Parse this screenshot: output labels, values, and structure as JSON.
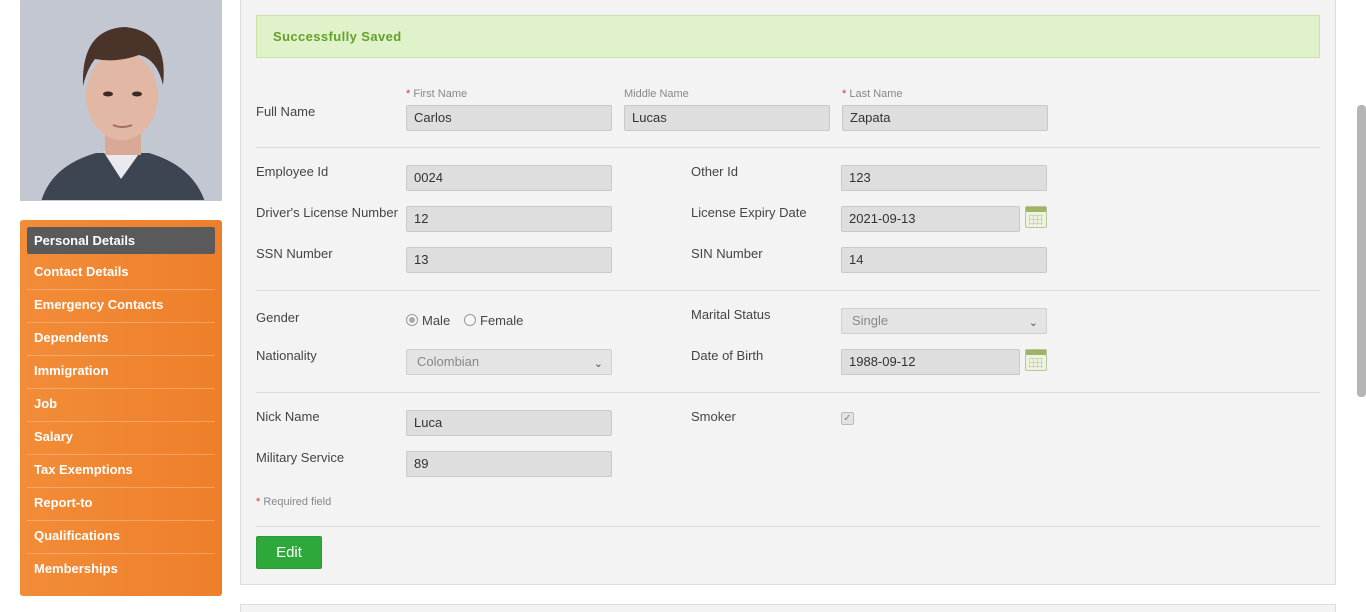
{
  "sidebar": {
    "items": [
      {
        "label": "Personal Details",
        "active": true
      },
      {
        "label": "Contact Details"
      },
      {
        "label": "Emergency Contacts"
      },
      {
        "label": "Dependents"
      },
      {
        "label": "Immigration"
      },
      {
        "label": "Job"
      },
      {
        "label": "Salary"
      },
      {
        "label": "Tax Exemptions"
      },
      {
        "label": "Report-to"
      },
      {
        "label": "Qualifications"
      },
      {
        "label": "Memberships"
      }
    ]
  },
  "alert": {
    "message": "Successfully Saved"
  },
  "form": {
    "full_name": {
      "label": "Full Name",
      "first_label": "First Name",
      "first_value": "Carlos",
      "middle_label": "Middle Name",
      "middle_value": "Lucas",
      "last_label": "Last Name",
      "last_value": "Zapata",
      "required_mark": "*"
    },
    "employee_id": {
      "label": "Employee Id",
      "value": "0024"
    },
    "other_id": {
      "label": "Other Id",
      "value": "123"
    },
    "drivers_license": {
      "label": "Driver's License Number",
      "value": "12"
    },
    "license_expiry": {
      "label": "License Expiry Date",
      "value": "2021-09-13"
    },
    "ssn": {
      "label": "SSN Number",
      "value": "13"
    },
    "sin": {
      "label": "SIN Number",
      "value": "14"
    },
    "gender": {
      "label": "Gender",
      "options": [
        "Male",
        "Female"
      ],
      "selected": "Male"
    },
    "marital_status": {
      "label": "Marital Status",
      "value": "Single"
    },
    "nationality": {
      "label": "Nationality",
      "value": "Colombian"
    },
    "dob": {
      "label": "Date of Birth",
      "value": "1988-09-12"
    },
    "nick_name": {
      "label": "Nick Name",
      "value": "Luca"
    },
    "smoker": {
      "label": "Smoker",
      "checked": true
    },
    "military_service": {
      "label": "Military Service",
      "value": "89"
    },
    "required_note": "Required field",
    "required_star": "*",
    "edit_label": "Edit"
  }
}
